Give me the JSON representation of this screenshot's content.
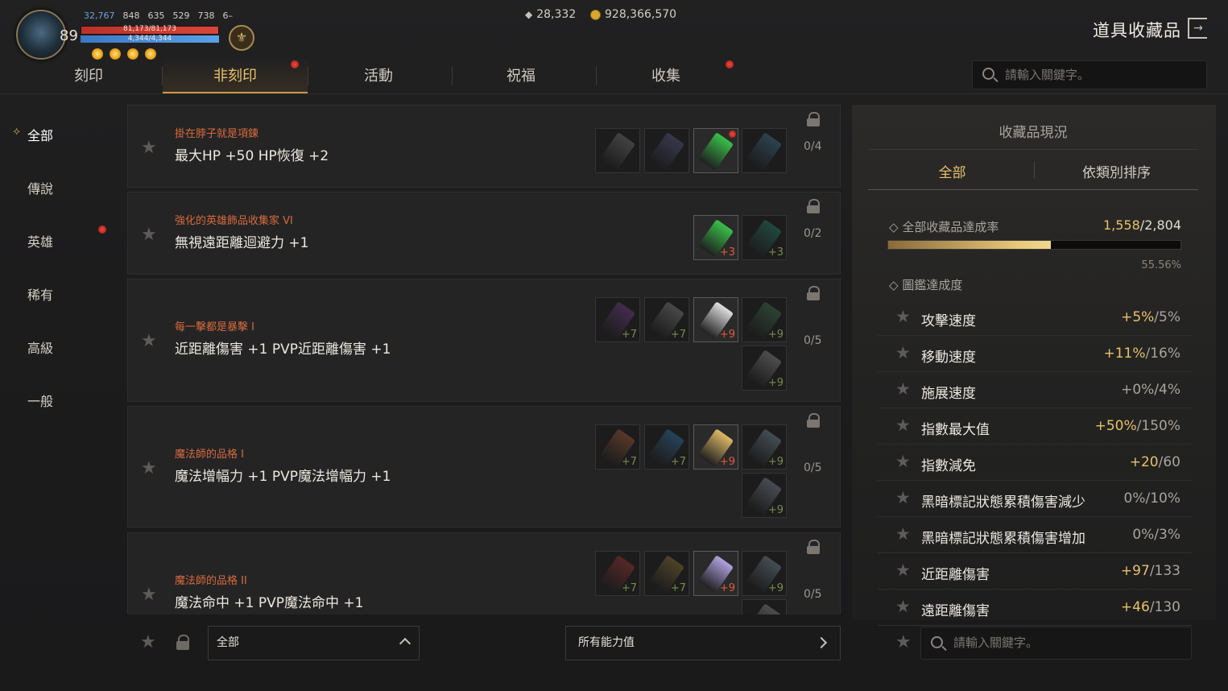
{
  "player": {
    "level": "89",
    "stats": [
      "32,767",
      "848",
      "635",
      "529",
      "738",
      "6–"
    ],
    "hp": "81,173/81,173",
    "mp": "4,344/4,344",
    "hp_fraction": 1.0,
    "mp_fraction": 1.0
  },
  "currency": {
    "gems": "28,332",
    "gold": "928,366,570"
  },
  "header": {
    "title": "道具收藏品"
  },
  "tabs": [
    {
      "label": "刻印",
      "active": false,
      "dot": false
    },
    {
      "label": "非刻印",
      "active": true,
      "dot": true
    },
    {
      "label": "活動",
      "active": false,
      "dot": false
    },
    {
      "label": "祝福",
      "active": false,
      "dot": false
    },
    {
      "label": "收集",
      "active": false,
      "dot": true
    }
  ],
  "search": {
    "placeholder": "請輸入關鍵字。"
  },
  "sidebar": {
    "items": [
      {
        "label": "全部",
        "active": true,
        "dot": false
      },
      {
        "label": "傳說",
        "active": false,
        "dot": false
      },
      {
        "label": "英雄",
        "active": false,
        "dot": true
      },
      {
        "label": "稀有",
        "active": false,
        "dot": false
      },
      {
        "label": "高級",
        "active": false,
        "dot": false
      },
      {
        "label": "一般",
        "active": false,
        "dot": false
      }
    ]
  },
  "collections": [
    {
      "category": "掛在脖子就是項鍊",
      "effect": "最大HP +50 HP恢復 +2",
      "count": "0/4",
      "items": [
        {
          "enh": "",
          "owned": false,
          "color": "#8a8a8a"
        },
        {
          "enh": "",
          "owned": false,
          "color": "#6a6aa8"
        },
        {
          "enh": "",
          "owned": true,
          "color": "#3ac84a",
          "dot": true
        },
        {
          "enh": "",
          "owned": false,
          "color": "#4a8aa8"
        }
      ]
    },
    {
      "category": "強化的英雄飾品收集家 VI",
      "effect": "無視遠距離迴避力 +1",
      "count": "0/2",
      "items": [
        {
          "enh": "+3",
          "owned": true,
          "color": "#3ac84a"
        },
        {
          "enh": "+3",
          "owned": false,
          "color": "#2a9a7a"
        }
      ]
    },
    {
      "category": "每一擊都是暴擊 I",
      "effect": "近距離傷害 +1 PVP近距離傷害 +1",
      "count": "0/5",
      "items": [
        {
          "enh": "+7",
          "owned": false,
          "color": "#8a4aa8"
        },
        {
          "enh": "+7",
          "owned": false,
          "color": "#9a9a9a"
        },
        {
          "enh": "+9",
          "owned": true,
          "color": "#e8e8e8"
        },
        {
          "enh": "+9",
          "owned": false,
          "color": "#4a8a5a"
        },
        {
          "enh": "+9",
          "owned": false,
          "color": "#a8a8a8"
        }
      ]
    },
    {
      "category": "魔法師的品格 I",
      "effect": "魔法增幅力 +1 PVP魔法增幅力 +1",
      "count": "0/5",
      "items": [
        {
          "enh": "+7",
          "owned": false,
          "color": "#c86a3a"
        },
        {
          "enh": "+7",
          "owned": false,
          "color": "#3a8ac8"
        },
        {
          "enh": "+9",
          "owned": true,
          "color": "#e8c06a"
        },
        {
          "enh": "+9",
          "owned": false,
          "color": "#8aa8b8"
        },
        {
          "enh": "+9",
          "owned": false,
          "color": "#9aa8b8"
        }
      ]
    },
    {
      "category": "魔法師的品格 II",
      "effect": "魔法命中 +1 PVP魔法命中 +1",
      "count": "0/5",
      "items": [
        {
          "enh": "+7",
          "owned": false,
          "color": "#c83a3a"
        },
        {
          "enh": "+7",
          "owned": false,
          "color": "#a88a3a"
        },
        {
          "enh": "+9",
          "owned": true,
          "color": "#b8a8e8"
        },
        {
          "enh": "+9",
          "owned": false,
          "color": "#8aa8b8"
        },
        {
          "enh": "",
          "owned": false,
          "color": "#a8a8a8"
        }
      ]
    }
  ],
  "bottom": {
    "filter": "全部",
    "all_stats": "所有能力值"
  },
  "panel": {
    "title": "收藏品現況",
    "tab_all": "全部",
    "tab_sort": "依類別排序",
    "rate_label": "全部收藏品達成率",
    "rate_current": "1,558",
    "rate_total": "/2,804",
    "rate_fraction": 0.5556,
    "rate_percent": "55.56%",
    "codex_label": "圖鑑達成度",
    "stats": [
      {
        "name": "攻擊速度",
        "cur": "+5%",
        "max": "/5%"
      },
      {
        "name": "移動速度",
        "cur": "+11%",
        "max": "/16%"
      },
      {
        "name": "施展速度",
        "cur": "+0%",
        "max": "/4%",
        "zero": true
      },
      {
        "name": "指數最大值",
        "cur": "+50%",
        "max": "/150%"
      },
      {
        "name": "指數減免",
        "cur": "+20",
        "max": "/60"
      },
      {
        "name": "黑暗標記狀態累積傷害減少",
        "cur": "0%",
        "max": "/10%",
        "zero": true
      },
      {
        "name": "黑暗標記狀態累積傷害增加",
        "cur": "0%",
        "max": "/3%",
        "zero": true
      },
      {
        "name": "近距離傷害",
        "cur": "+97",
        "max": "/133"
      },
      {
        "name": "遠距離傷害",
        "cur": "+46",
        "max": "/130"
      }
    ],
    "search_placeholder": "請輸入關鍵字。"
  }
}
